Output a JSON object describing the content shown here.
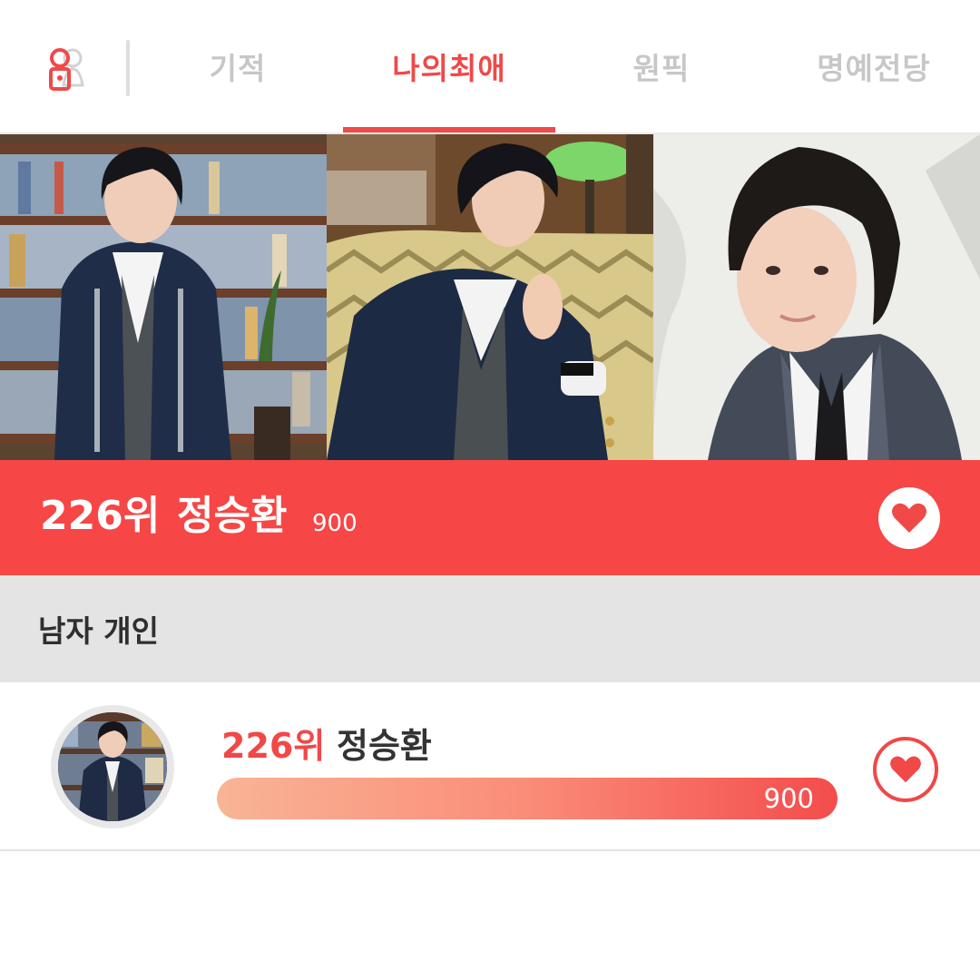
{
  "nav": {
    "tabs": [
      {
        "label": "기적",
        "active": false
      },
      {
        "label": "나의최애",
        "active": true
      },
      {
        "label": "원픽",
        "active": false
      },
      {
        "label": "명예전당",
        "active": false
      }
    ]
  },
  "gallery": {
    "photos": [
      {
        "description_icon": "idol-photo-library"
      },
      {
        "description_icon": "idol-photo-sofa"
      },
      {
        "description_icon": "idol-photo-selfie"
      }
    ]
  },
  "banner": {
    "rank": "226위",
    "name": "정승환",
    "votes": "900"
  },
  "category": {
    "label": "남자 개인"
  },
  "ranking": {
    "items": [
      {
        "rank": "226위",
        "name": "정승환",
        "votes": "900",
        "progress": 1.0
      }
    ]
  },
  "colors": {
    "accent": "#f14848",
    "banner": "#f64646",
    "category_bg": "#e4e4e4",
    "tab_inactive": "#c7c7c7"
  }
}
